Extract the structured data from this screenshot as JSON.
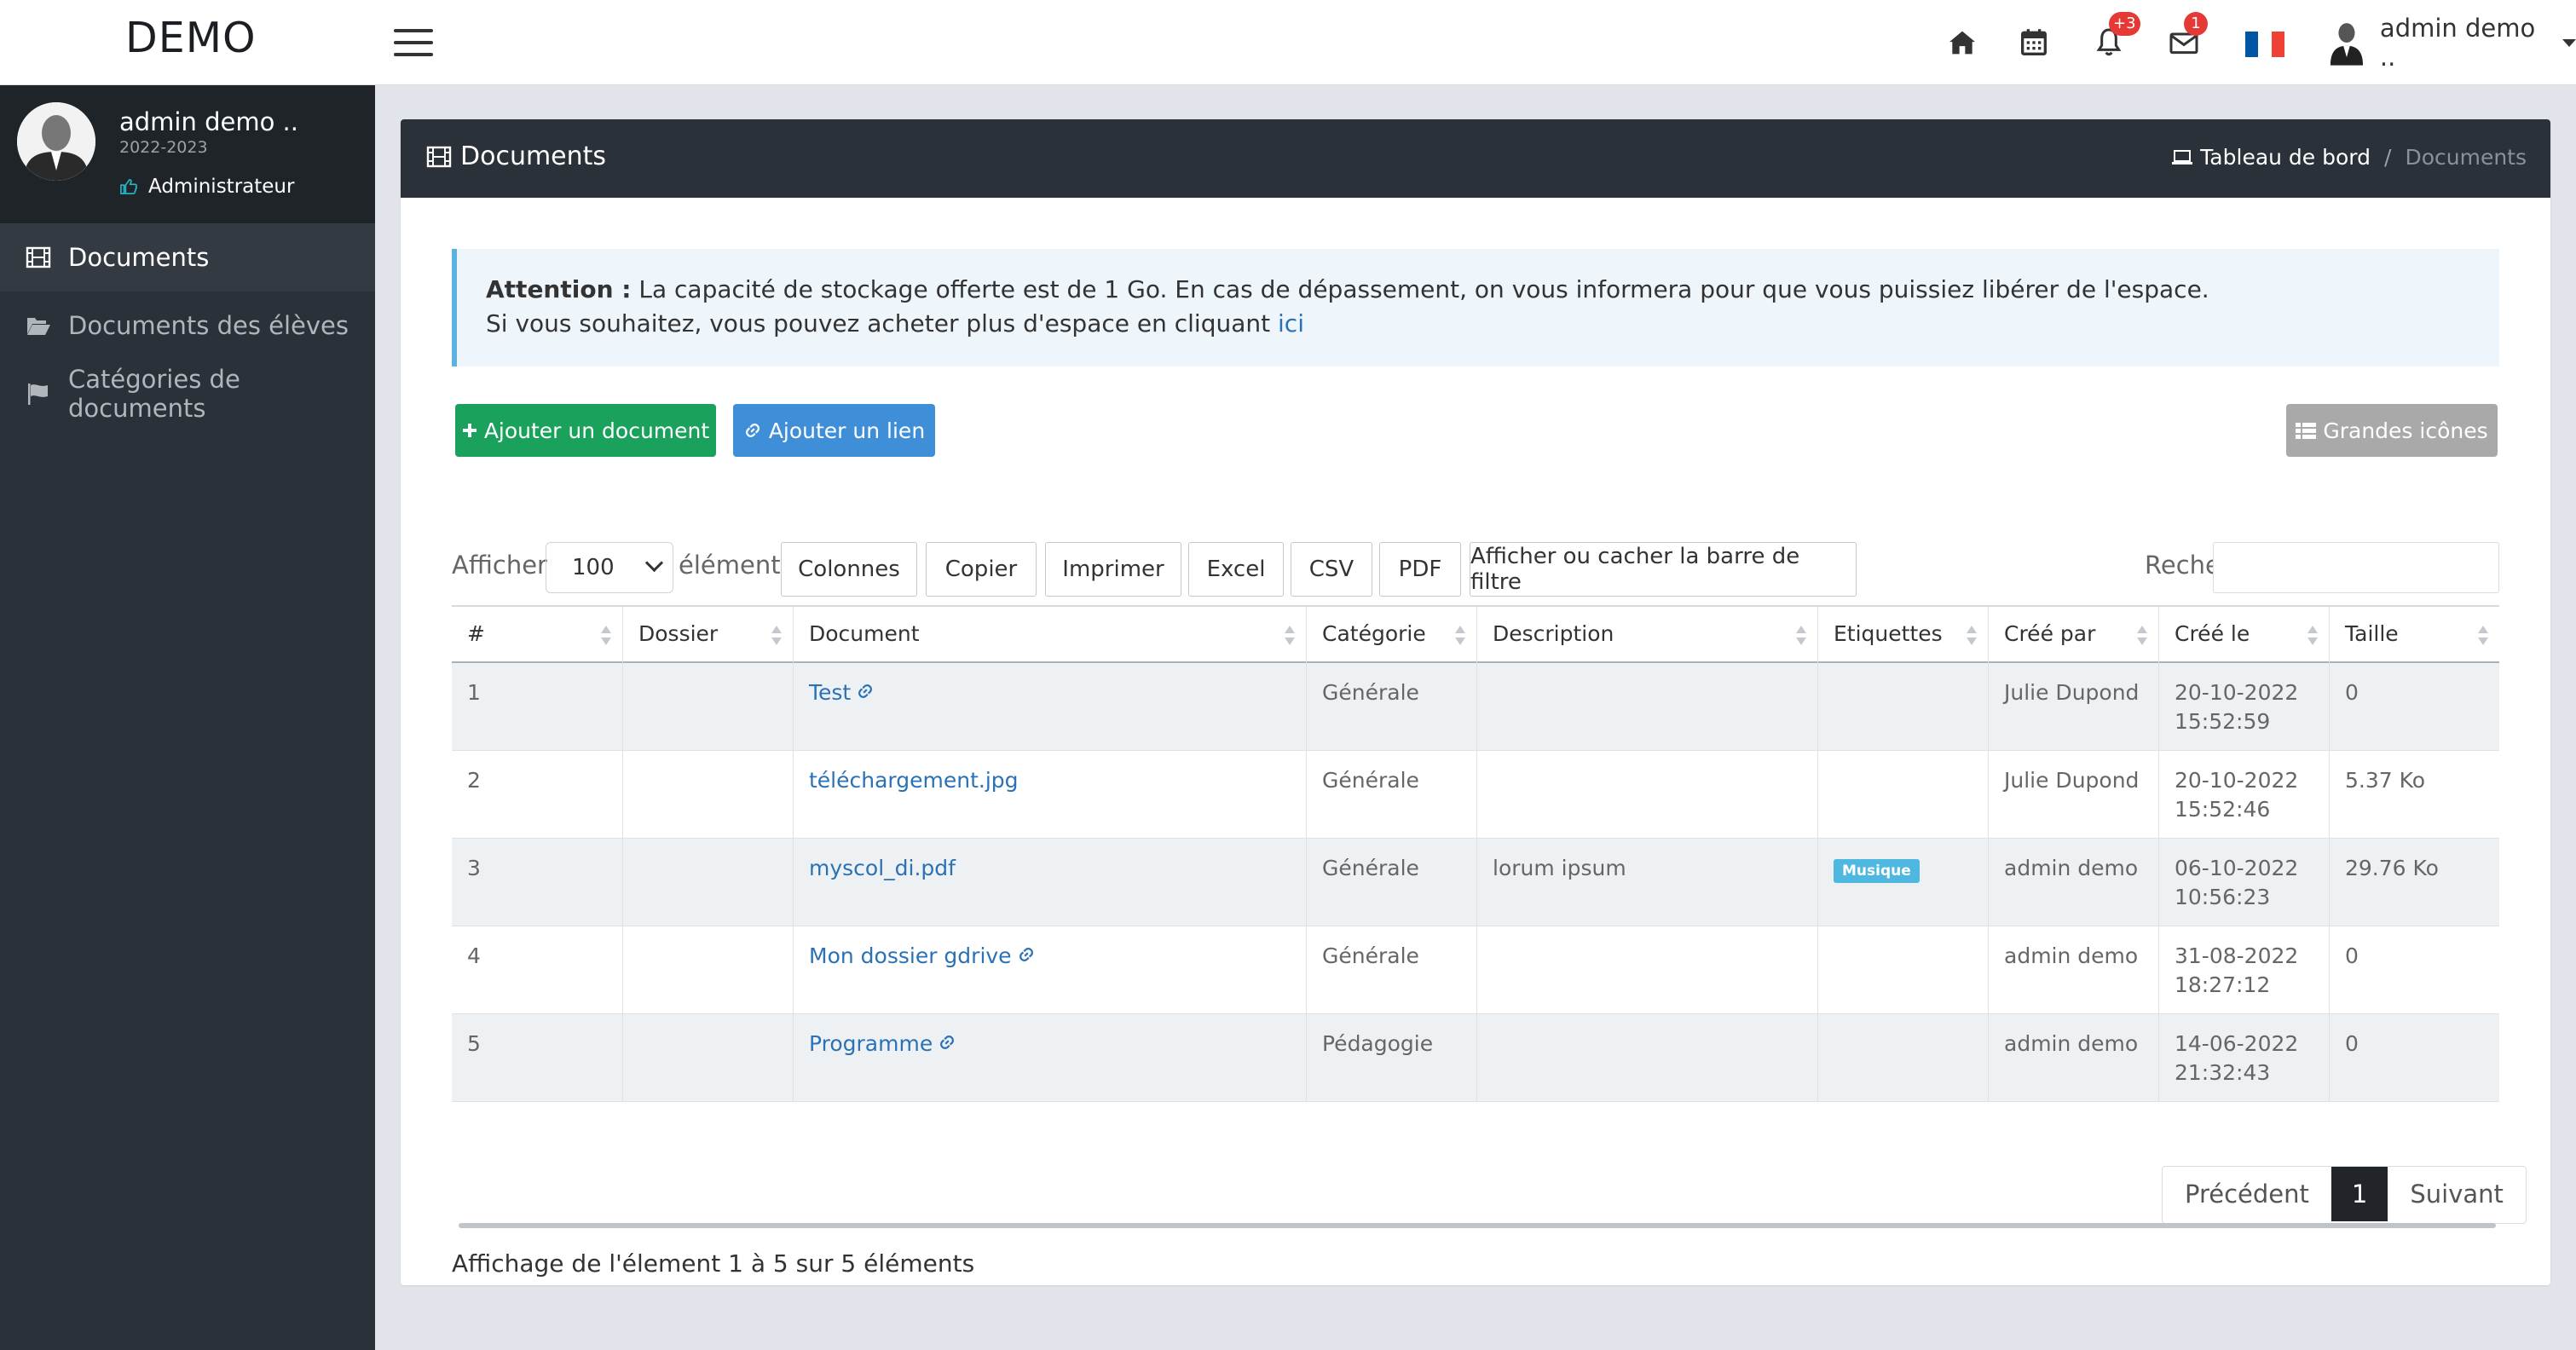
{
  "app": {
    "brand": "DEMO"
  },
  "topbar": {
    "notifications_count": "+3",
    "messages_count": "1",
    "user_name": "admin demo ..",
    "flag_colors": [
      "#0055a4",
      "#ffffff",
      "#ef4135"
    ]
  },
  "sidebar": {
    "profile": {
      "name": "admin demo ..",
      "year": "2022-2023",
      "role": "Administrateur"
    },
    "items": [
      {
        "label": "Documents",
        "icon": "film-icon",
        "active": true
      },
      {
        "label": "Documents des élèves",
        "icon": "folder-open-icon",
        "active": false
      },
      {
        "label": "Catégories de documents",
        "icon": "flag-icon",
        "active": false
      }
    ]
  },
  "card": {
    "title": "Documents",
    "breadcrumb": {
      "home": "Tableau de bord",
      "separator": "/",
      "current": "Documents"
    }
  },
  "alert": {
    "strong": "Attention :",
    "line1": " La capacité de stockage offerte est de 1 Go. En cas de dépassement, on vous informera pour que vous puissiez libérer de l'espace.",
    "line2": "Si vous souhaitez, vous pouvez acheter plus d'espace en cliquant ",
    "link": "ici"
  },
  "actions": {
    "add_document": "Ajouter un document",
    "add_link": "Ajouter un lien",
    "big_icons": "Grandes icônes"
  },
  "datatable": {
    "show_label": "Afficher",
    "page_length": "100",
    "elements_label": "éléments",
    "buttons": [
      "Colonnes",
      "Copier",
      "Imprimer",
      "Excel",
      "CSV",
      "PDF",
      "Afficher ou cacher la barre de filtre"
    ],
    "search_label": "Rechercher :",
    "search_value": "",
    "columns": [
      "#",
      "Dossier",
      "Document",
      "Catégorie",
      "Description",
      "Etiquettes",
      "Créé par",
      "Créé le",
      "Taille"
    ],
    "rows": [
      {
        "num": "1",
        "folder": "",
        "document": "Test",
        "is_link": true,
        "category": "Générale",
        "description": "",
        "tag": "",
        "created_by": "Julie Dupond",
        "date": "20-10-2022",
        "time": "15:52:59",
        "size": "0"
      },
      {
        "num": "2",
        "folder": "",
        "document": "téléchargement.jpg",
        "is_link": false,
        "category": "Générale",
        "description": "",
        "tag": "",
        "created_by": "Julie Dupond",
        "date": "20-10-2022",
        "time": "15:52:46",
        "size": "5.37 Ko"
      },
      {
        "num": "3",
        "folder": "",
        "document": "myscol_di.pdf",
        "is_link": false,
        "category": "Générale",
        "description": "lorum ipsum",
        "tag": "Musique",
        "created_by": "admin demo",
        "date": "06-10-2022",
        "time": "10:56:23",
        "size": "29.76 Ko"
      },
      {
        "num": "4",
        "folder": "",
        "document": "Mon dossier gdrive",
        "is_link": true,
        "category": "Générale",
        "description": "",
        "tag": "",
        "created_by": "admin demo",
        "date": "31-08-2022",
        "time": "18:27:12",
        "size": "0"
      },
      {
        "num": "5",
        "folder": "",
        "document": "Programme",
        "is_link": true,
        "category": "Pédagogie",
        "description": "",
        "tag": "",
        "created_by": "admin demo",
        "date": "14-06-2022",
        "time": "21:32:43",
        "size": "0"
      }
    ],
    "info": "Affichage de l'élement 1 à 5 sur 5 éléments",
    "pagination": {
      "previous": "Précédent",
      "current": "1",
      "next": "Suivant"
    }
  }
}
